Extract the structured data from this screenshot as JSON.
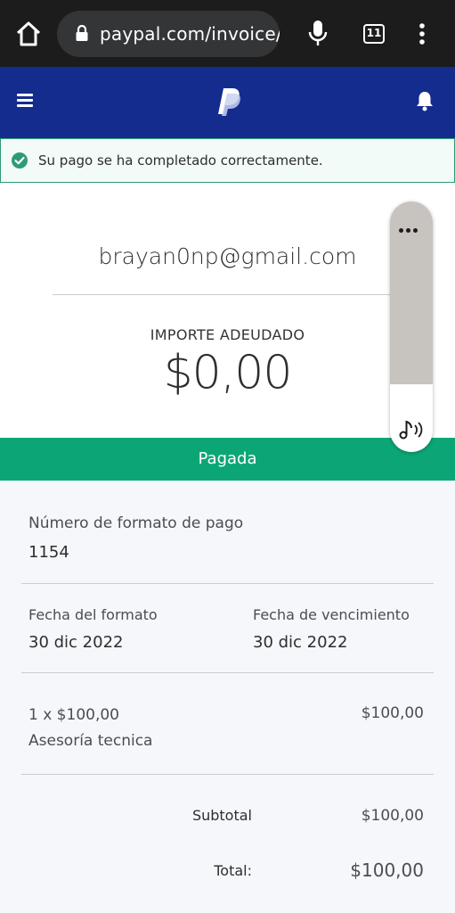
{
  "browser": {
    "url": "paypal.com/invoice/",
    "tab_count": "11"
  },
  "banner": {
    "message": "Su pago se ha completado correctamente."
  },
  "invoice": {
    "email": "brayan0np@gmail.com",
    "amount_label": "IMPORTE ADEUDADO",
    "amount_value": "$0,00",
    "status": "Pagada"
  },
  "details": {
    "invoice_number_label": "Número de formato de pago",
    "invoice_number": "1154",
    "invoice_date_label": "Fecha del formato",
    "invoice_date": "30 dic 2022",
    "due_date_label": "Fecha de vencimiento",
    "due_date": "30 dic 2022",
    "item_qty_price": "1  x $100,00",
    "item_name": "Asesoría tecnica",
    "item_total": "$100,00",
    "subtotal_label": "Subtotal",
    "subtotal": "$100,00",
    "total_label": "Total:",
    "total": "$100,00"
  },
  "colors": {
    "brand_blue": "#142c8e",
    "status_green": "#0ca676"
  }
}
